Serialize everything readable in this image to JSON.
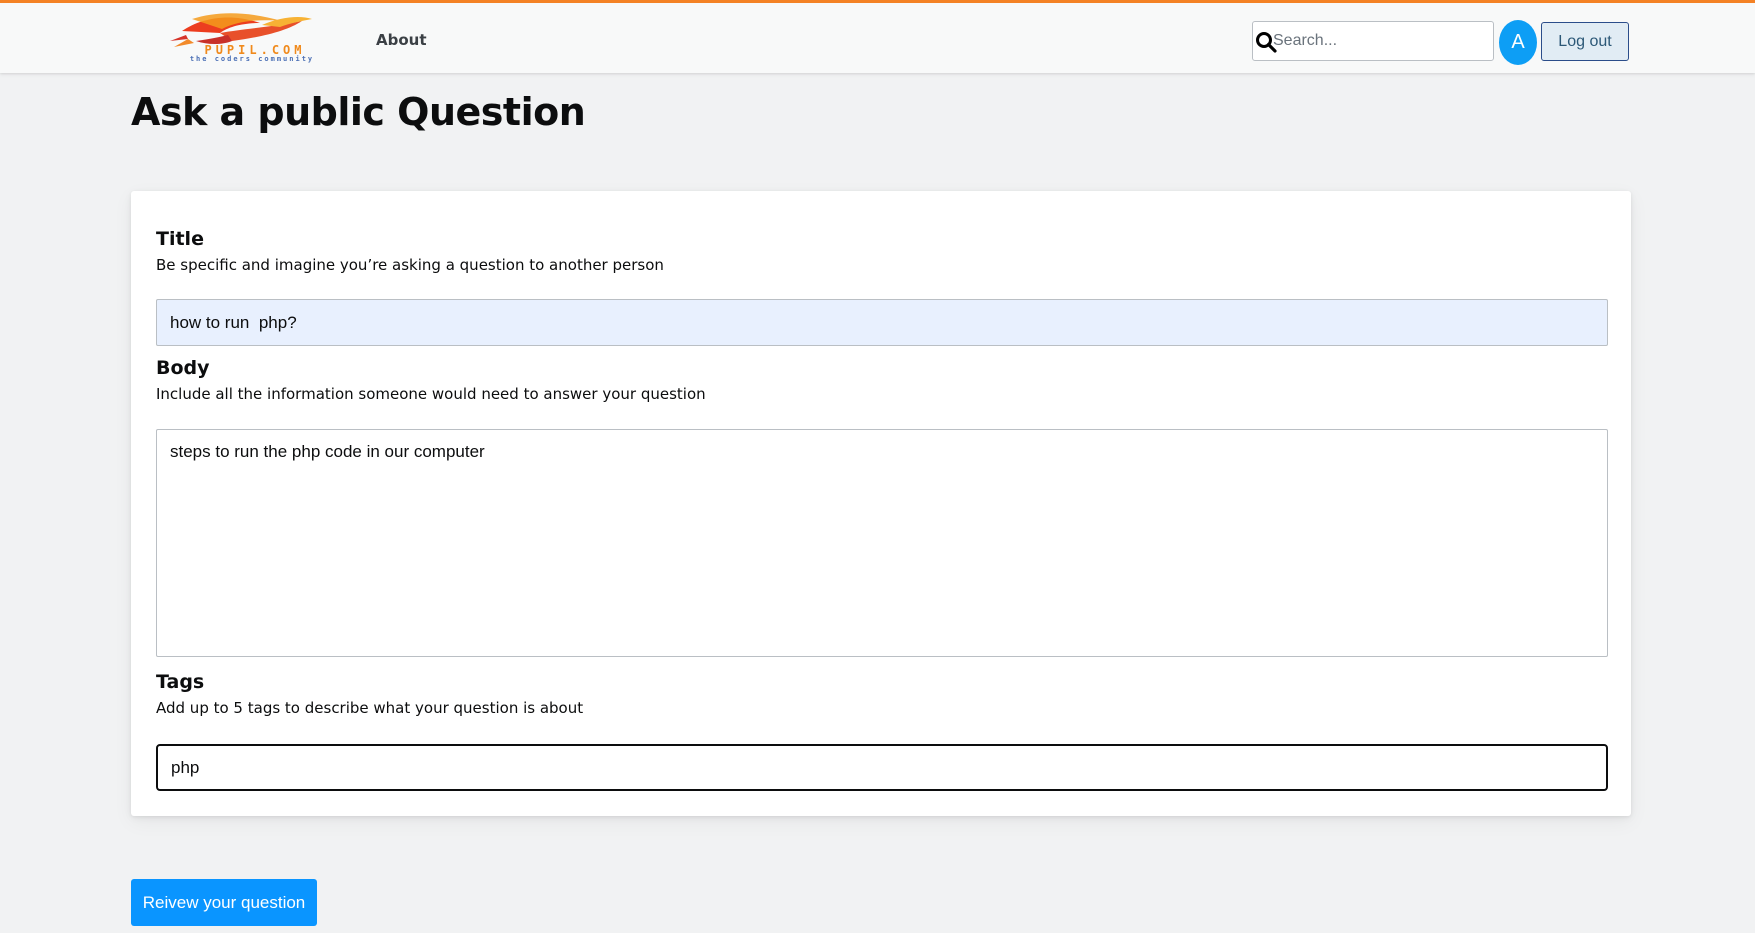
{
  "header": {
    "logo": {
      "brand_text": "PUPIL.COM",
      "tagline": "the coders community",
      "colors": {
        "bird": "#ec3d1f",
        "wing": "#f59b1c",
        "tagline": "#4a6fb5"
      }
    },
    "nav": {
      "about_label": "About"
    },
    "search": {
      "placeholder": "Search...",
      "icon": "search-icon"
    },
    "avatar": {
      "initial": "A",
      "color": "#0d9ef5"
    },
    "logout_label": "Log out",
    "accent_color": "#f48225"
  },
  "page": {
    "title": "Ask a public Question"
  },
  "form": {
    "title_field": {
      "label": "Title",
      "description": "Be specific and imagine you’re asking a question to another person",
      "value": "how to run  php?"
    },
    "body_field": {
      "label": "Body",
      "description": "Include all the information someone would need to answer your question",
      "value": "steps to run the php code in our computer"
    },
    "tags_field": {
      "label": "Tags",
      "description": "Add up to 5 tags to describe what your question is about",
      "value": "php"
    },
    "submit_label": "Reivew your question",
    "submit_color": "#0a95ff"
  }
}
